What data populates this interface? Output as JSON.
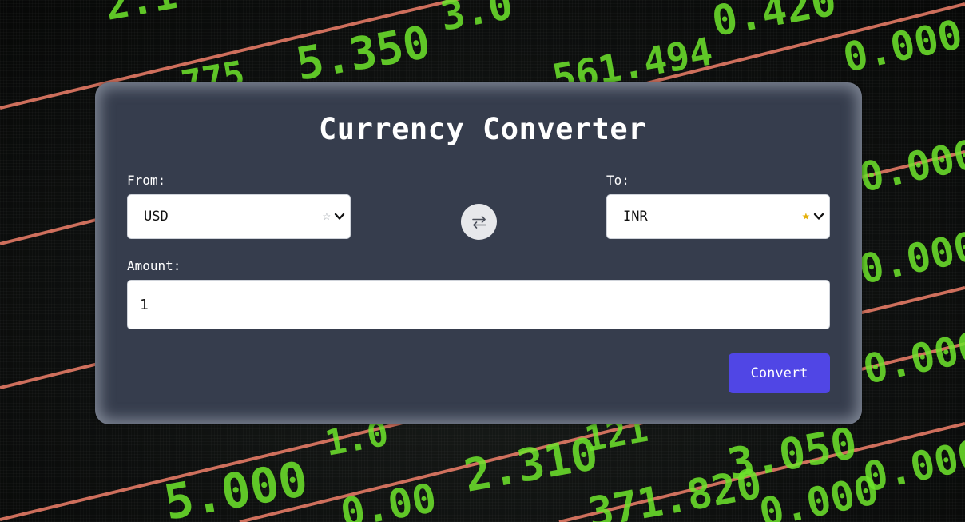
{
  "app": {
    "title": "Currency Converter"
  },
  "from": {
    "label": "From:",
    "selected": "USD",
    "favorite": false,
    "star_glyph": "☆",
    "star_color": "#9aa0a8"
  },
  "to": {
    "label": "To:",
    "selected": "INR",
    "favorite": true,
    "star_glyph": "★",
    "star_color": "#e5b10c"
  },
  "amount": {
    "label": "Amount:",
    "value": "1"
  },
  "actions": {
    "convert_label": "Convert"
  },
  "background": {
    "ticker_values": [
      "2.1",
      "5.350",
      "3.0",
      "0.420",
      "775",
      "561.494",
      "0.000",
      "0.000",
      "0.000",
      "0.000",
      "0.000",
      "1.0",
      "2.310",
      "121",
      "3.050",
      "5.000",
      "0.00",
      "371.820",
      "0.000"
    ]
  },
  "colors": {
    "card_bg": "#363d4d",
    "accent": "#5046e5",
    "ticker_green": "#6ee62c",
    "stripe": "#f0806a"
  },
  "icons": {
    "swap": "swap-arrows-icon",
    "chevron": "chevron-down-icon",
    "favorite": "star-icon"
  }
}
